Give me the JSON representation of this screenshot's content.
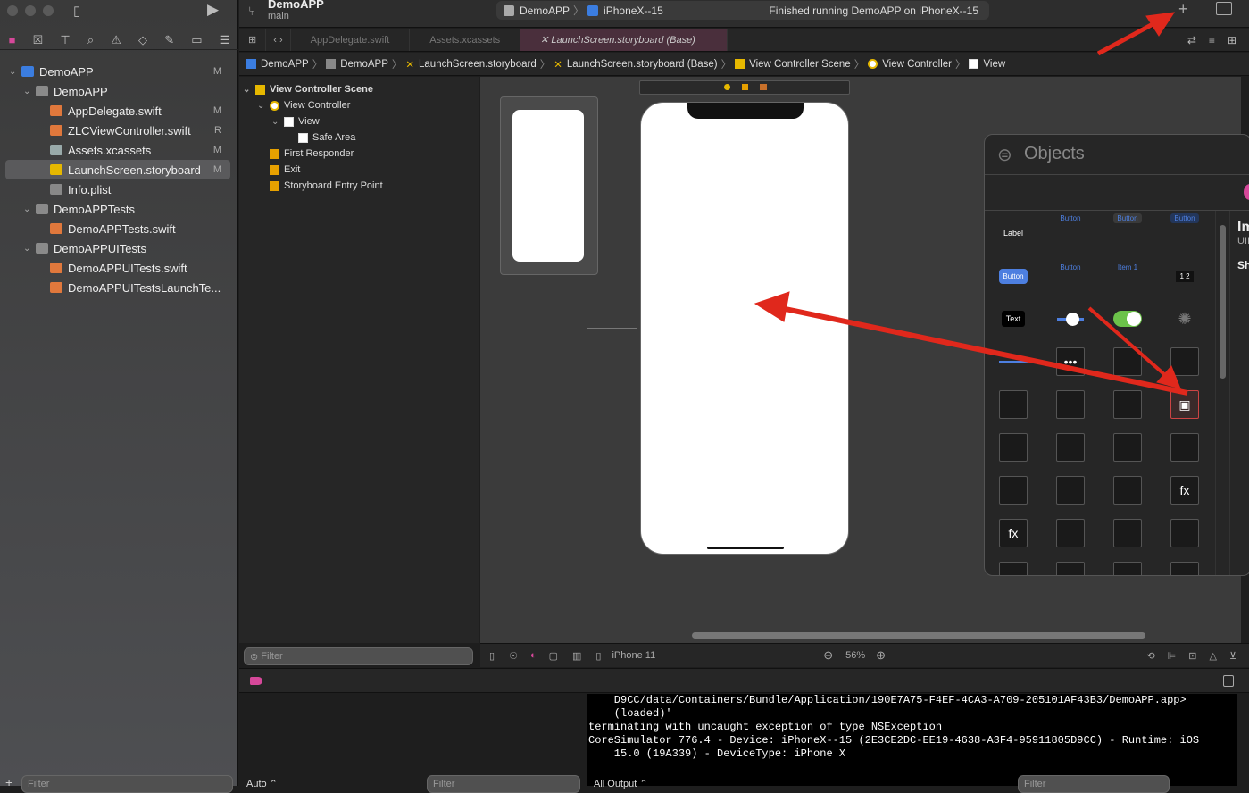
{
  "toolbar": {
    "project": "DemoAPP",
    "branch": "main",
    "scheme": "DemoAPP",
    "device": "iPhoneX--15",
    "status": "Finished running DemoAPP on iPhoneX--15"
  },
  "navigator": {
    "items": [
      {
        "label": "DemoAPP",
        "status": "M",
        "level": 0,
        "icon": "project-icon",
        "chev": true
      },
      {
        "label": "DemoAPP",
        "status": "",
        "level": 1,
        "icon": "folder-icon",
        "chev": true
      },
      {
        "label": "AppDelegate.swift",
        "status": "M",
        "level": 2,
        "icon": "swift-file-icon"
      },
      {
        "label": "ZLCViewController.swift",
        "status": "R",
        "level": 2,
        "icon": "swift-file-icon"
      },
      {
        "label": "Assets.xcassets",
        "status": "M",
        "level": 2,
        "icon": "assets-icon"
      },
      {
        "label": "LaunchScreen.storyboard",
        "status": "M",
        "level": 2,
        "icon": "storyboard-icon",
        "selected": true
      },
      {
        "label": "Info.plist",
        "status": "",
        "level": 2,
        "icon": "plist-icon"
      },
      {
        "label": "DemoAPPTests",
        "status": "",
        "level": 1,
        "icon": "folder-icon",
        "chev": true
      },
      {
        "label": "DemoAPPTests.swift",
        "status": "",
        "level": 2,
        "icon": "swift-file-icon"
      },
      {
        "label": "DemoAPPUITests",
        "status": "",
        "level": 1,
        "icon": "folder-icon",
        "chev": true
      },
      {
        "label": "DemoAPPUITests.swift",
        "status": "",
        "level": 2,
        "icon": "swift-file-icon"
      },
      {
        "label": "DemoAPPUITestsLaunchTe...",
        "status": "",
        "level": 2,
        "icon": "swift-file-icon"
      }
    ],
    "filter_placeholder": "Filter"
  },
  "tabs": [
    {
      "label": "AppDelegate.swift"
    },
    {
      "label": "Assets.xcassets"
    },
    {
      "label": "LaunchScreen.storyboard (Base)",
      "active": true
    }
  ],
  "breadcrumb": [
    "DemoAPP",
    "DemoAPP",
    "LaunchScreen.storyboard",
    "LaunchScreen.storyboard (Base)",
    "View Controller Scene",
    "View Controller",
    "View"
  ],
  "outline": {
    "items": [
      {
        "label": "View Controller Scene",
        "level": 0,
        "bold": true
      },
      {
        "label": "View Controller",
        "level": 1
      },
      {
        "label": "View",
        "level": 2
      },
      {
        "label": "Safe Area",
        "level": 3
      },
      {
        "label": "First Responder",
        "level": 1
      },
      {
        "label": "Exit",
        "level": 1
      },
      {
        "label": "Storyboard Entry Point",
        "level": 1
      }
    ],
    "filter_placeholder": "Filter"
  },
  "canvas_toolbar": {
    "device": "iPhone 11",
    "zoom": "56%"
  },
  "objects": {
    "title": "Objects",
    "detail_title": "Im",
    "detail_sub": "UII",
    "detail_sh": "Sh",
    "cells": [
      "Label",
      "Button",
      "Button",
      "Button",
      "Button",
      "Button",
      "Item 1",
      "1 2",
      "Text",
      "",
      "",
      "",
      "",
      "•••",
      "—",
      "",
      "",
      "",
      "",
      "",
      "",
      "",
      "",
      "",
      "",
      "",
      "",
      "fx",
      "fx",
      "",
      "",
      "",
      "",
      "",
      "",
      ""
    ]
  },
  "debug": {
    "auto": "Auto ⌃",
    "filter_placeholder": "Filter",
    "output": "All Output ⌃"
  },
  "console": {
    "lines": [
      "    D9CC/data/Containers/Bundle/Application/190E7A75-F4EF-4CA3-A709-205101AF43B3/DemoAPP.app>",
      "    (loaded)'",
      "terminating with uncaught exception of type NSException",
      "CoreSimulator 776.4 - Device: iPhoneX--15 (2E3CE2DC-EE19-4638-A3F4-95911805D9CC) - Runtime: iOS",
      "    15.0 (19A339) - DeviceType: iPhone X"
    ]
  },
  "colors": {
    "accent": "#d6489a",
    "arrow": "#e0281c",
    "link": "#4d7fe0"
  }
}
